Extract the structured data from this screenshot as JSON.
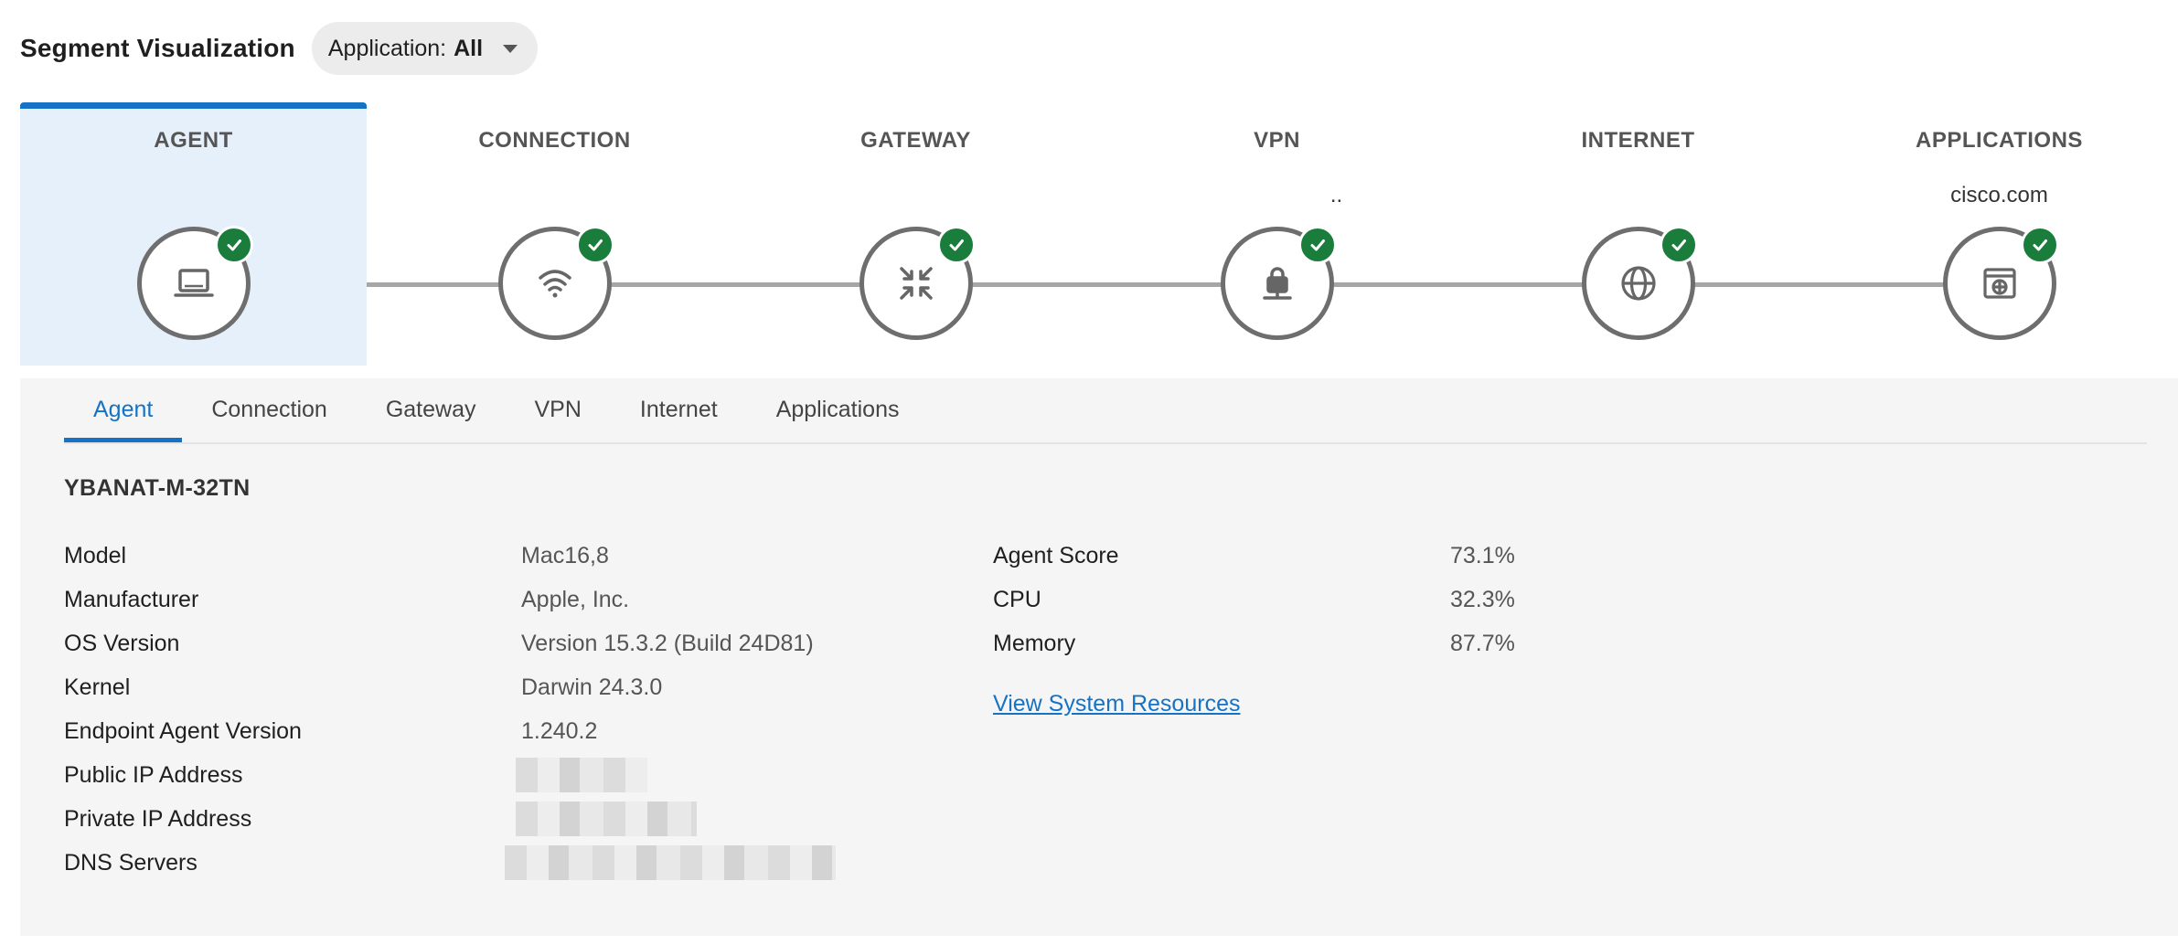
{
  "header": {
    "title": "Segment Visualization",
    "filter_label": "Application:",
    "filter_value": "All"
  },
  "segments": [
    {
      "title": "AGENT",
      "subtitle": "",
      "icon": "laptop-icon",
      "status": "ok"
    },
    {
      "title": "CONNECTION",
      "subtitle": "",
      "icon": "wifi-icon",
      "status": "ok"
    },
    {
      "title": "GATEWAY",
      "subtitle": "",
      "icon": "gateway-arrows-icon",
      "status": "ok"
    },
    {
      "title": "VPN",
      "subtitle": "..",
      "icon": "vpn-lock-icon",
      "status": "ok"
    },
    {
      "title": "INTERNET",
      "subtitle": "",
      "icon": "globe-icon",
      "status": "ok"
    },
    {
      "title": "APPLICATIONS",
      "subtitle": "cisco.com",
      "icon": "app-window-icon",
      "status": "ok"
    }
  ],
  "tabs": [
    "Agent",
    "Connection",
    "Gateway",
    "VPN",
    "Internet",
    "Applications"
  ],
  "agent": {
    "device_name": "YBANAT-M-32TN",
    "properties": [
      {
        "label": "Model",
        "value": "Mac16,8"
      },
      {
        "label": "Manufacturer",
        "value": "Apple, Inc."
      },
      {
        "label": "OS Version",
        "value": "Version 15.3.2 (Build 24D81)"
      },
      {
        "label": "Kernel",
        "value": "Darwin 24.3.0"
      },
      {
        "label": "Endpoint Agent Version",
        "value": "1.240.2"
      },
      {
        "label": "Public IP Address",
        "value": ""
      },
      {
        "label": "Private IP Address",
        "value": ""
      },
      {
        "label": "DNS Servers",
        "value": ""
      }
    ],
    "stats": [
      {
        "label": "Agent Score",
        "value": "73.1%"
      },
      {
        "label": "CPU",
        "value": "32.3%"
      },
      {
        "label": "Memory",
        "value": "87.7%"
      }
    ],
    "link": "View System Resources"
  },
  "colors": {
    "accent": "#1572c4",
    "success": "#1a7d3c",
    "active_bg": "#e5f0fa"
  }
}
